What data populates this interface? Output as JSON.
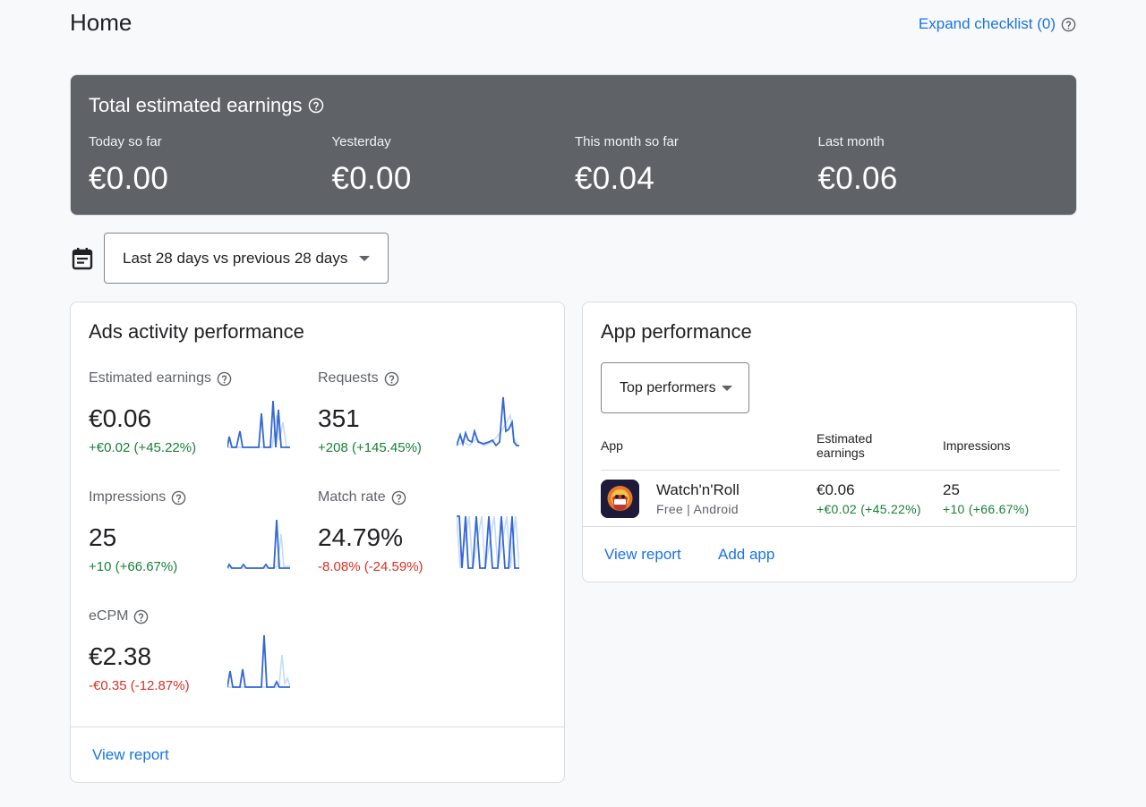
{
  "header": {
    "title": "Home",
    "expand_checklist": "Expand checklist (0)"
  },
  "earnings": {
    "title": "Total estimated earnings",
    "items": [
      {
        "label": "Today so far",
        "value": "€0.00"
      },
      {
        "label": "Yesterday",
        "value": "€0.00"
      },
      {
        "label": "This month so far",
        "value": "€0.04"
      },
      {
        "label": "Last month",
        "value": "€0.06"
      }
    ]
  },
  "date_range": {
    "selected": "Last 28 days vs previous 28 days"
  },
  "ads_activity": {
    "title": "Ads activity performance",
    "metrics": [
      {
        "label": "Estimated earnings",
        "value": "€0.06",
        "change": "+€0.02 (+45.22%)",
        "trend": "positive"
      },
      {
        "label": "Requests",
        "value": "351",
        "change": "+208 (+145.45%)",
        "trend": "positive"
      },
      {
        "label": "Impressions",
        "value": "25",
        "change": "+10 (+66.67%)",
        "trend": "positive"
      },
      {
        "label": "Match rate",
        "value": "24.79%",
        "change": "-8.08% (-24.59%)",
        "trend": "negative"
      },
      {
        "label": "eCPM",
        "value": "€2.38",
        "change": "-€0.35 (-12.87%)",
        "trend": "negative"
      }
    ],
    "view_report": "View report"
  },
  "app_performance": {
    "title": "App performance",
    "filter": "Top performers",
    "columns": [
      "App",
      "Estimated earnings",
      "Impressions"
    ],
    "rows": [
      {
        "name": "Watch'n'Roll",
        "subtitle": "Free | Android",
        "earnings": "€0.06",
        "earnings_change": "+€0.02 (+45.22%)",
        "impressions": "25",
        "impressions_change": "+10 (+66.67%)"
      }
    ],
    "view_report": "View report",
    "add_app": "Add app"
  },
  "colors": {
    "accent": "#1a73e8",
    "positive": "#188038",
    "negative": "#d93025",
    "earnings_bg": "#5f6368",
    "spark_current": "#3367d6",
    "spark_previous": "#c6dafc"
  }
}
